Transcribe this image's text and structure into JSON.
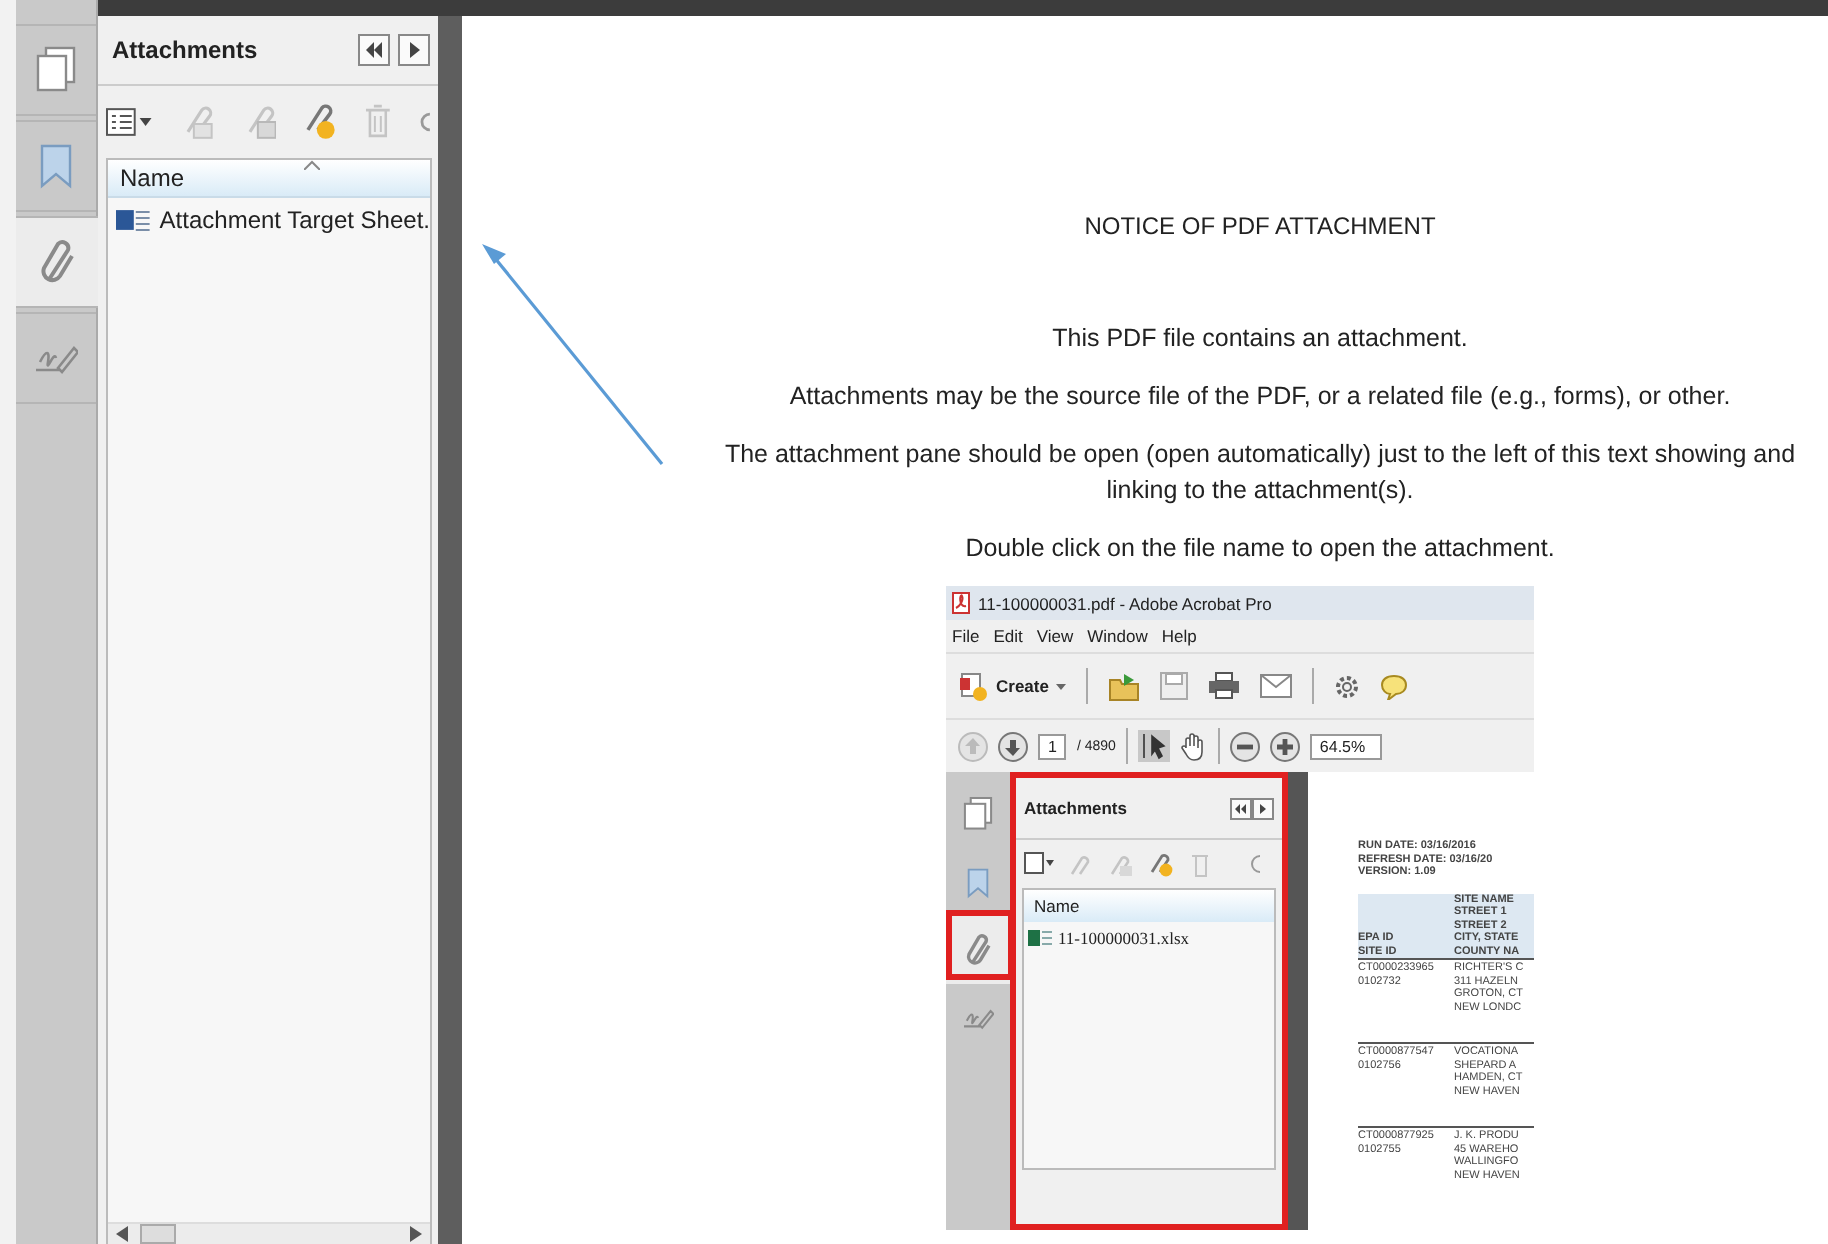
{
  "sidebar_tabs": [
    {
      "selected": false
    },
    {
      "selected": false
    },
    {
      "selected": true
    },
    {
      "selected": false
    }
  ],
  "panel": {
    "title": "Attachments",
    "column": "Name",
    "files": [
      {
        "name": "Attachment Target Sheet.",
        "selected": false
      }
    ]
  },
  "document": {
    "heading": "NOTICE OF PDF ATTACHMENT",
    "paragraphs": [
      {
        "lines": [
          "This PDF file contains an attachment."
        ]
      },
      {
        "lines": [
          "Attachments may be the source file of the PDF, or a related file (e.g., forms), or other."
        ]
      },
      {
        "lines": [
          "The attachment pane should be open (open automatically) just to the left of this text showing and",
          "linking to the attachment(s)."
        ]
      },
      {
        "lines": [
          "Double click on the file name to open the attachment."
        ]
      }
    ],
    "embedded_screenshot": {
      "title": "11-100000031.pdf - Adobe Acrobat Pro",
      "menu": [
        "File",
        "Edit",
        "View",
        "Window",
        "Help"
      ],
      "create_label": "Create",
      "page": "1",
      "page_count": "/ 4890",
      "zoom": "64.5%",
      "sidebar_tabs": [
        {
          "selected": false
        },
        {
          "selected": false
        },
        {
          "selected": true
        },
        {
          "selected": false
        }
      ],
      "panel": {
        "title": "Attachments",
        "column": "Name",
        "files": [
          {
            "name": "11-100000031.xlsx"
          }
        ]
      },
      "report": {
        "header_lines": [
          "RUN DATE: 03/16/2016",
          "REFRESH DATE: 03/16/20",
          "VERSION: 1.09"
        ],
        "columns": [
          {
            "lines": [
              "EPA ID",
              "SITE ID"
            ]
          },
          {
            "lines": [
              "SITE NAME",
              "STREET 1",
              "STREET 2",
              "CITY, STATE",
              "COUNTY NA"
            ]
          }
        ],
        "rows": [
          {
            "cells": [
              [
                "CT0000233965",
                "0102732"
              ],
              [
                "RICHTER'S C",
                "311 HAZELN",
                "GROTON, CT",
                "NEW LONDC"
              ]
            ]
          },
          {
            "cells": [
              [
                "CT0000877547",
                "0102756"
              ],
              [
                "VOCATIONA",
                "SHEPARD A",
                "HAMDEN, CT",
                "NEW HAVEN"
              ]
            ]
          },
          {
            "cells": [
              [
                "CT0000877925",
                "0102755"
              ],
              [
                "J. K. PRODU",
                "45 WAREHO",
                "WALLINGFO",
                "NEW HAVEN"
              ]
            ]
          }
        ]
      }
    }
  }
}
